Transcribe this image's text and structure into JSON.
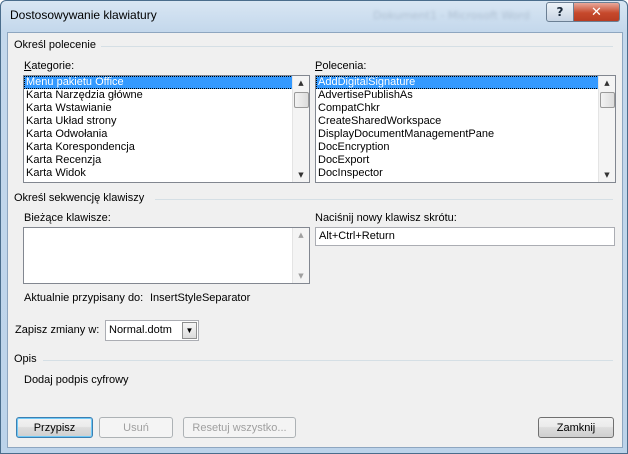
{
  "window": {
    "title": "Dostosowywanie klawiatury",
    "background_title": "Dokument1 - Microsoft Word",
    "help_glyph": "?",
    "close_glyph": "✕"
  },
  "command_group": {
    "title": "Określ polecenie",
    "categories_label": "Kategorie:",
    "categories": [
      "Menu pakietu Office",
      "Karta Narzędzia główne",
      "Karta Wstawianie",
      "Karta Układ strony",
      "Karta Odwołania",
      "Karta Korespondencja",
      "Karta Recenzja",
      "Karta Widok"
    ],
    "commands_label": "Polecenia:",
    "commands": [
      "AddDigitalSignature",
      "AdvertisePublishAs",
      "CompatChkr",
      "CreateSharedWorkspace",
      "DisplayDocumentManagementPane",
      "DocEncryption",
      "DocExport",
      "DocInspector"
    ]
  },
  "shortcut_group": {
    "title": "Określ sekwencję klawiszy",
    "current_keys_label": "Bieżące klawisze:",
    "new_key_label": "Naciśnij nowy klawisz skrótu:",
    "new_key_value": "Alt+Ctrl+Return",
    "currently_assigned_label": "Aktualnie przypisany do:",
    "currently_assigned_value": "InsertStyleSeparator"
  },
  "save_changes": {
    "label": "Zapisz zmiany w:",
    "value": "Normal.dotm"
  },
  "description_group": {
    "title": "Opis",
    "text": "Dodaj podpis cyfrowy"
  },
  "buttons": {
    "assign": "Przypisz",
    "remove": "Usuń",
    "reset_all": "Resetuj wszystko...",
    "close": "Zamknij"
  }
}
